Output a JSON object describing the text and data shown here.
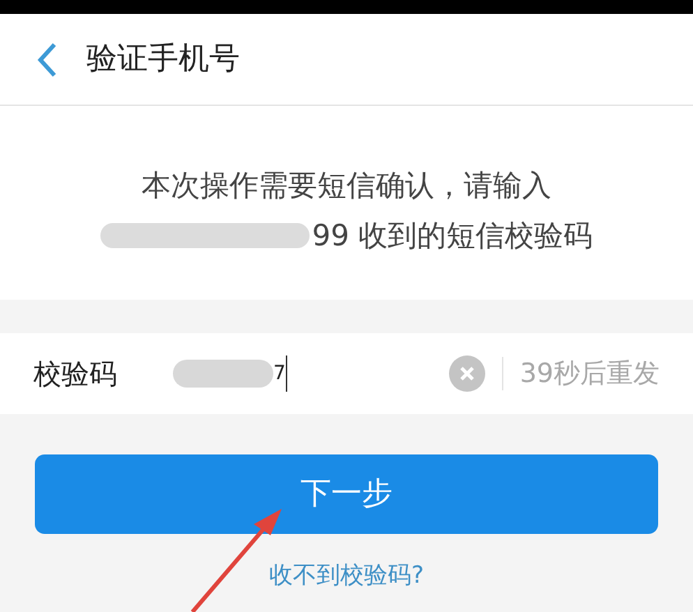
{
  "header": {
    "title": "验证手机号"
  },
  "message": {
    "line_1": "本次操作需要短信确认，请输入",
    "line_2": "99 收到的短信校验码"
  },
  "code_field": {
    "label": "校验码",
    "value": "7",
    "resend": "39秒后重发"
  },
  "next_button": {
    "label": "下一步"
  },
  "help_link": {
    "label": "收不到校验码?"
  }
}
